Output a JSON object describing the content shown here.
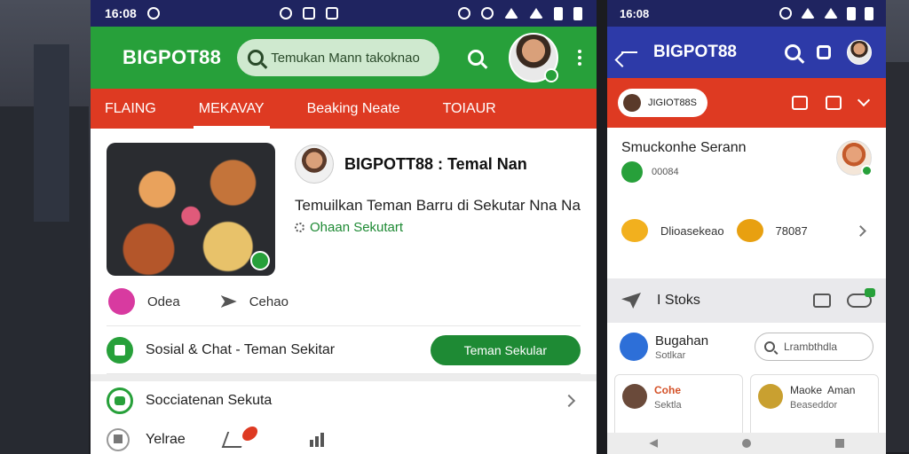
{
  "phone_a": {
    "status": {
      "time": "16:08"
    },
    "appbar": {
      "brand": "BIGPOT88",
      "search_placeholder": "Temukan Mann takoknao"
    },
    "tabs": [
      {
        "label": "FLAING"
      },
      {
        "label": "MEKAVAY"
      },
      {
        "label": "Beaking Neate"
      },
      {
        "label": "TOIAUR"
      }
    ],
    "card": {
      "title": "BIGPOTT88 : Temal Nan",
      "description": "Temuilkan Teman Barru di Sekutar Nna Na",
      "link": "Ohaan Sekutart",
      "actions": [
        {
          "label": "Odea"
        },
        {
          "label": "Cehao"
        }
      ]
    },
    "social_row": {
      "label": "Sosial & Chat - Teman Sekitar",
      "button": "Teman Sekular"
    },
    "list": {
      "item1": "Socciatenan Sekuta",
      "item2": "Yelrae"
    }
  },
  "phone_b": {
    "status": {
      "time": "16:08"
    },
    "appbar": {
      "brand": "BIGPOT88"
    },
    "redbar": {
      "pill": "JIGIOT88S"
    },
    "section1": {
      "title": "Smuckonhe Serann",
      "sub": "00084"
    },
    "section2": {
      "label": "Dlioasekeao",
      "value": "78087"
    },
    "strip": {
      "label": "I Stoks"
    },
    "row": {
      "title": "Bugahan",
      "sub": "Sotlkar",
      "search_placeholder": "Lrambthdla"
    },
    "cards": [
      {
        "title": "Cohe",
        "sub": "Sektla"
      },
      {
        "title": "Maoke",
        "extra": "Aman",
        "sub": "Beaseddor"
      }
    ]
  },
  "colors": {
    "green": "#27a03a",
    "red": "#de3a22",
    "blue": "#2d3aa8",
    "navy": "#1f2460"
  }
}
